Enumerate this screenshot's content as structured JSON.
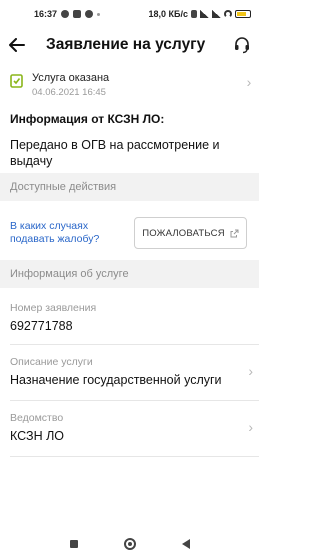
{
  "status_bar": {
    "time": "16:37",
    "network_speed": "18,0 КБ/с",
    "battery": "100"
  },
  "app_bar": {
    "title": "Заявление на услугу",
    "back_icon": "arrow-left-icon",
    "support_icon": "headset-icon"
  },
  "order_status": {
    "title": "Услуга оказана",
    "date": "04.06.2021 16:45",
    "icon": "document-check-icon",
    "icon_color": "#8ab51a"
  },
  "info": {
    "heading": "Информация от КСЗН ЛО:",
    "body": "Передано в ОГВ на рассмотрение и выдачу"
  },
  "sections": {
    "actions": "Доступные действия",
    "service_info": "Информация об услуге"
  },
  "actions": {
    "complaint_link": "В каких случаях подавать жалобу?",
    "complain_button": "ПОЖАЛОВАТЬСЯ",
    "link_color": "#2a67c9"
  },
  "fields": {
    "number": {
      "label": "Номер заявления",
      "value": "692771788"
    },
    "description": {
      "label": "Описание услуги",
      "value": "Назначение государственной услуги"
    },
    "department": {
      "label": "Ведомство",
      "value": "КСЗН ЛО"
    }
  }
}
